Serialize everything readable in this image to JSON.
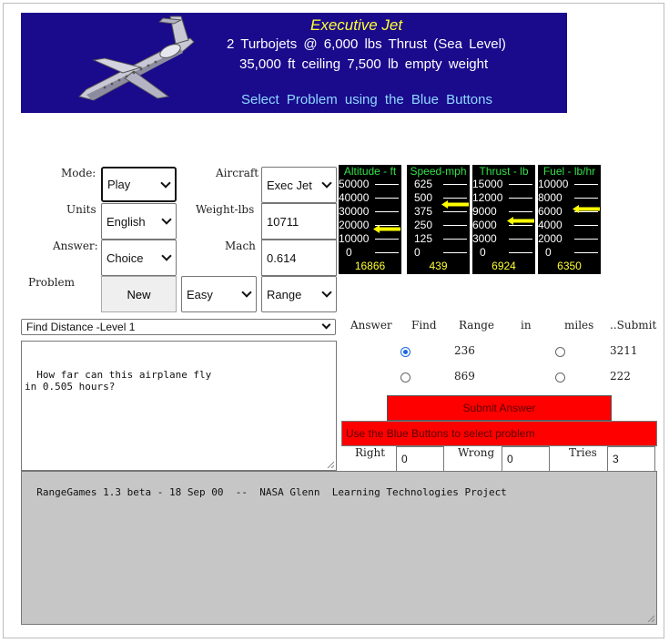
{
  "banner": {
    "title": "Executive Jet",
    "line1": "2  Turbojets  @ 6,000  lbs  Thrust (Sea Level)",
    "line2": "35,000 ft ceiling    7,500 lb  empty weight",
    "line3": "Select  Problem  using  the  Blue Buttons",
    "image": "airplane-image"
  },
  "controls": {
    "mode_label": "Mode:",
    "mode_value": "Play",
    "units_label": "Units",
    "units_value": "English",
    "answer_label": "Answer:",
    "answer_value": "Choice",
    "problem_label": "Problem",
    "new_button": "New",
    "aircraft_label": "Aircraft",
    "aircraft_value": "Exec Jet",
    "weight_label": "Weight-lbs",
    "weight_value": "10711",
    "mach_label": "Mach",
    "mach_value": "0.614",
    "difficulty_value": "Easy",
    "problem_type_value": "Range"
  },
  "gauges": [
    {
      "title": "Altitude - ft",
      "ticks": [
        "50000",
        "40000",
        "30000",
        "20000",
        "10000",
        "0"
      ],
      "reading": "16866",
      "level": 0.337
    },
    {
      "title": "Speed-mph",
      "ticks": [
        "625",
        "500",
        "375",
        "250",
        "125",
        "0"
      ],
      "reading": "439",
      "level": 0.702
    },
    {
      "title": "Thrust - lb",
      "ticks": [
        "15000",
        "12000",
        "9000",
        "6000",
        "3000",
        "0"
      ],
      "reading": "6924",
      "level": 0.462
    },
    {
      "title": "Fuel - lb/hr",
      "ticks": [
        "10000",
        "8000",
        "6000",
        "4000",
        "2000",
        "0"
      ],
      "reading": "6350",
      "level": 0.635
    }
  ],
  "problem": {
    "select_value": "Find Distance -Level 1",
    "question": "How far can this airplane fly\nin 0.505 hours?",
    "status_log": "RangeGames 1.3 beta - 18 Sep 00  --  NASA Glenn  Learning Technologies Project"
  },
  "answer_panel": {
    "headers": [
      "Answer",
      "Find",
      "Range",
      "in",
      "miles",
      "..Submit"
    ],
    "choices": [
      {
        "left": "236",
        "right": "3211",
        "left_selected": true,
        "right_selected": false
      },
      {
        "left": "869",
        "right": "222",
        "left_selected": false,
        "right_selected": false
      }
    ],
    "submit_button": "Submit Answer",
    "message": "Use the Blue Buttons to select problem",
    "right_label": "Right",
    "right_value": "0",
    "wrong_label": "Wrong",
    "wrong_value": "0",
    "tries_label": "Tries",
    "tries_value": "3"
  },
  "colors": {
    "banner_bg": "#1a0a8c",
    "gauge_title": "#33e04a",
    "gauge_reading": "#ffff33",
    "indicator_arrow": "#ffff00",
    "submit_bg": "#ff0000"
  }
}
